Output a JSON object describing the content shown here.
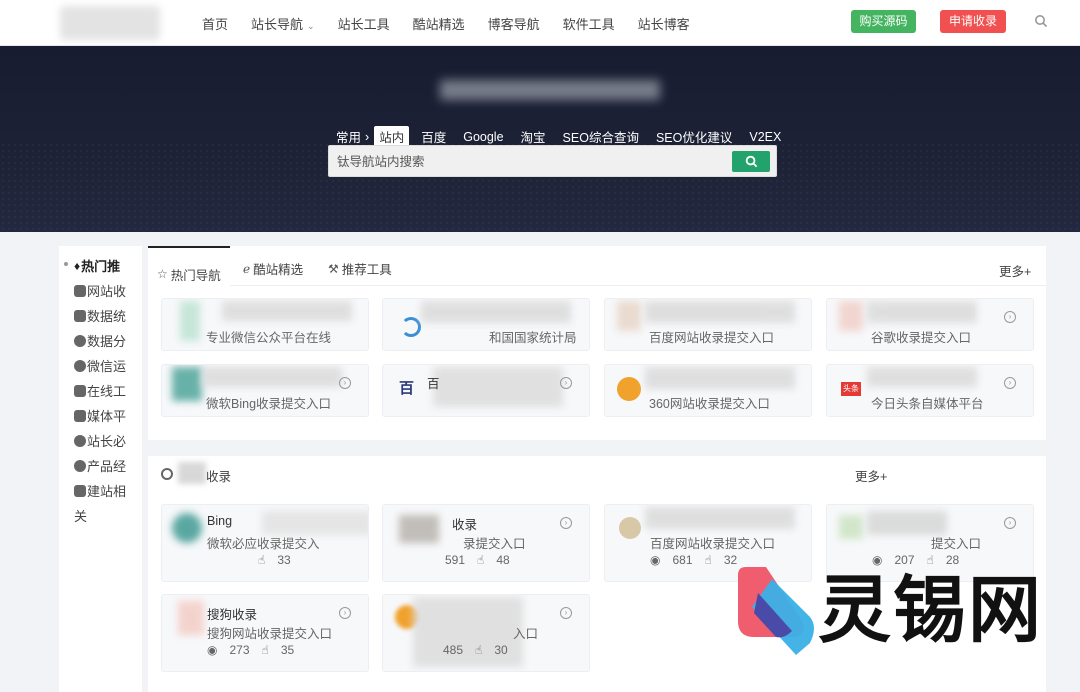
{
  "nav": {
    "items": [
      "首页",
      "站长导航",
      "站长工具",
      "酷站精选",
      "博客导航",
      "软件工具",
      "站长博客"
    ],
    "buy_label": "购买源码",
    "apply_label": "申请收录"
  },
  "hero": {
    "tabs": [
      "常用",
      "站内",
      "百度",
      "Google",
      "淘宝",
      "SEO综合查询",
      "SEO优化建议",
      "V2EX"
    ],
    "active_tab": "站内",
    "search_placeholder": "钛导航站内搜索"
  },
  "sidebar": {
    "items": [
      "热门推",
      "网站收",
      "数据统",
      "数据分",
      "微信运",
      "在线工",
      "媒体平",
      "站长必",
      "产品经",
      "建站相",
      "关"
    ]
  },
  "panel1": {
    "tabs": [
      "热门导航",
      "酷站精选",
      "推荐工具"
    ],
    "more": "更多+",
    "cards": [
      {
        "desc": "专业微信公众平台在线"
      },
      {
        "desc": "和国国家统计局"
      },
      {
        "desc": "百度网站收录提交入口"
      },
      {
        "desc": "谷歌收录提交入口"
      },
      {
        "desc": "微软Bing收录提交入口"
      },
      {
        "desc": "百"
      },
      {
        "desc": "360网站收录提交入口"
      },
      {
        "desc": "今日头条自媒体平台"
      }
    ]
  },
  "panel2": {
    "title": "收录",
    "more": "更多+",
    "cards": [
      {
        "title": "Bing",
        "desc": "微软必应收录提交入",
        "views": "",
        "likes": "33"
      },
      {
        "title": "收录",
        "desc": "录提交入口",
        "views": "591",
        "likes": "48"
      },
      {
        "title": "",
        "desc": "百度网站收录提交入口",
        "views": "681",
        "likes": "32"
      },
      {
        "title": "",
        "desc": "提交入口",
        "views": "207",
        "likes": "28"
      },
      {
        "title": "搜狗收录",
        "desc": "搜狗网站收录提交入口",
        "views": "273",
        "likes": "35"
      },
      {
        "title": "",
        "desc": "入口",
        "views": "485",
        "likes": "30"
      }
    ]
  },
  "watermark": {
    "text": "灵锡网"
  },
  "colors": {
    "buy": "#45b461",
    "apply": "#f0504f",
    "search_btn": "#22a36d",
    "hero": "#1b2034"
  }
}
